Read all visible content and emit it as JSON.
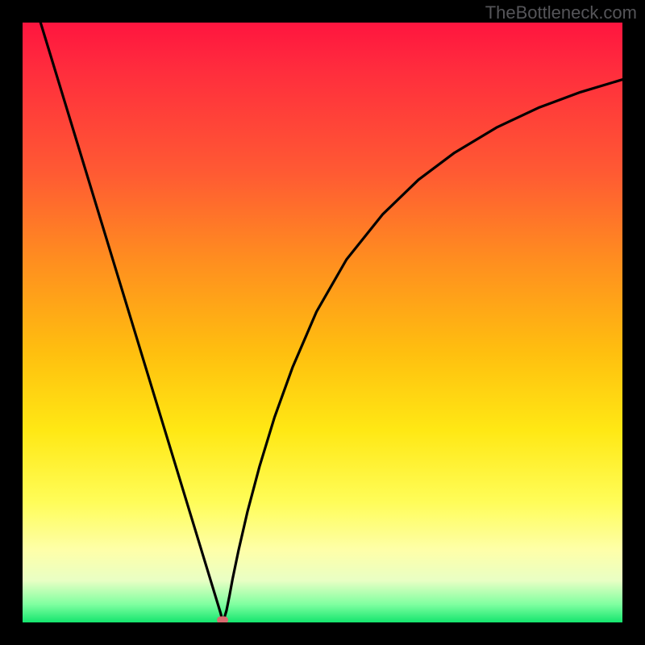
{
  "watermark": "TheBottleneck.com",
  "chart_data": {
    "type": "line",
    "title": "",
    "xlabel": "",
    "ylabel": "",
    "xlim": [
      0,
      1
    ],
    "ylim": [
      0,
      1
    ],
    "series": [
      {
        "name": "curve",
        "x": [
          0.03,
          0.055,
          0.08,
          0.105,
          0.13,
          0.155,
          0.18,
          0.205,
          0.23,
          0.255,
          0.28,
          0.305,
          0.33,
          0.334,
          0.34,
          0.345,
          0.35,
          0.36,
          0.375,
          0.395,
          0.42,
          0.45,
          0.49,
          0.54,
          0.6,
          0.66,
          0.72,
          0.79,
          0.86,
          0.93,
          1.0
        ],
        "y": [
          1.0,
          0.918,
          0.836,
          0.754,
          0.672,
          0.59,
          0.508,
          0.426,
          0.344,
          0.262,
          0.18,
          0.098,
          0.016,
          0.0,
          0.02,
          0.045,
          0.072,
          0.12,
          0.185,
          0.26,
          0.342,
          0.425,
          0.518,
          0.605,
          0.68,
          0.738,
          0.783,
          0.825,
          0.858,
          0.884,
          0.905
        ]
      }
    ],
    "marker": {
      "x": 0.334,
      "y": 0.0
    },
    "gradient_stops": [
      {
        "pos": 0.0,
        "color": "#ff153f"
      },
      {
        "pos": 0.25,
        "color": "#ff5a33"
      },
      {
        "pos": 0.55,
        "color": "#ffbf0f"
      },
      {
        "pos": 0.8,
        "color": "#fffd59"
      },
      {
        "pos": 0.97,
        "color": "#7fffa0"
      },
      {
        "pos": 1.0,
        "color": "#15e56e"
      }
    ]
  }
}
